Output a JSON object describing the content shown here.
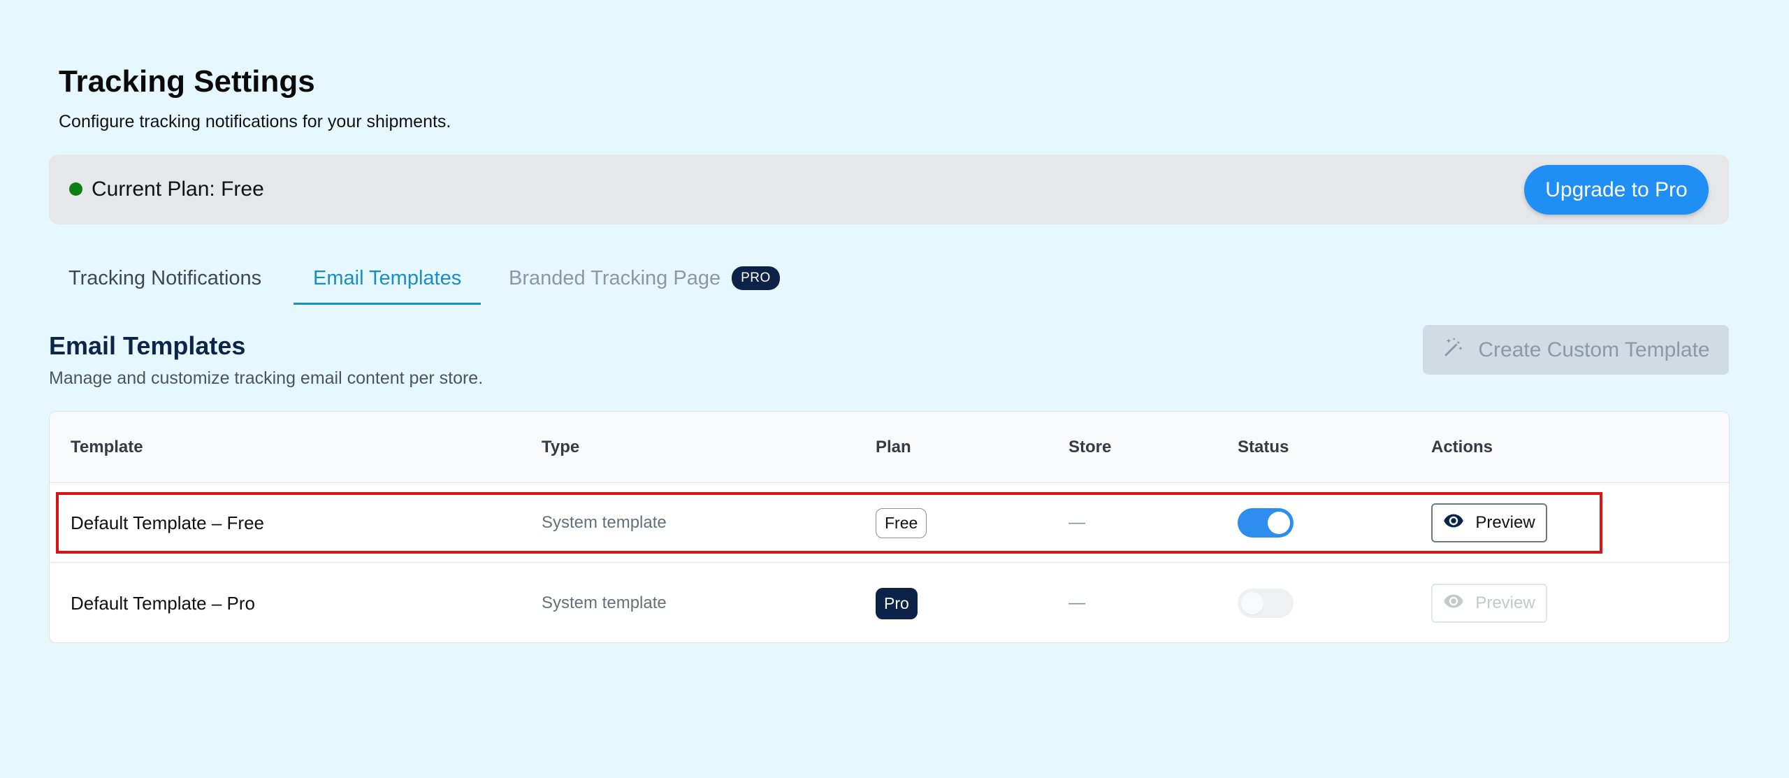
{
  "header": {
    "title": "Tracking Settings",
    "subtitle": "Configure tracking notifications for your shipments."
  },
  "plan": {
    "label": "Current Plan: Free",
    "status_color": "#0e7d12",
    "upgrade_label": "Upgrade to Pro"
  },
  "tabs": [
    {
      "label": "Tracking Notifications",
      "active": false
    },
    {
      "label": "Email Templates",
      "active": true
    },
    {
      "label": "Branded Tracking Page",
      "active": false,
      "badge": "PRO"
    }
  ],
  "section": {
    "title": "Email Templates",
    "subtitle": "Manage and customize tracking email content per store.",
    "create_label": "Create Custom Template",
    "create_icon": "magic-wand-icon",
    "create_disabled": true
  },
  "table": {
    "headers": {
      "template": "Template",
      "type": "Type",
      "plan": "Plan",
      "store": "Store",
      "status": "Status",
      "actions": "Actions"
    },
    "rows": [
      {
        "template": "Default Template – Free",
        "type": "System template",
        "plan": "Free",
        "store": "—",
        "status_on": true,
        "action": "Preview",
        "action_icon": "eye-icon",
        "action_disabled": false
      },
      {
        "template": "Default Template – Pro",
        "type": "System template",
        "plan": "Pro",
        "store": "—",
        "status_on": false,
        "action": "Preview",
        "action_icon": "eye-icon",
        "action_disabled": true
      }
    ]
  },
  "colors": {
    "background": "#e6f8fd",
    "accent": "#1f8ef5",
    "tab_active": "#1a8cc7",
    "navy": "#0d2248",
    "highlight": "#d81414"
  }
}
